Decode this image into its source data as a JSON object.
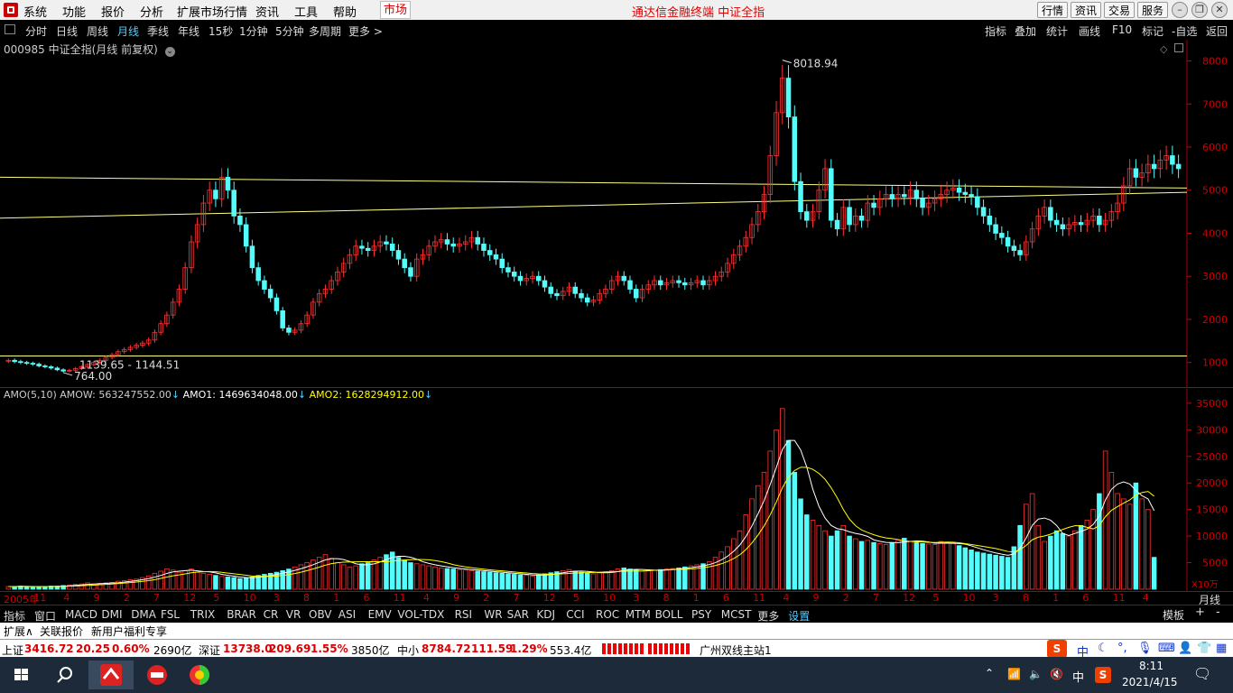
{
  "menubar": {
    "items": [
      "系统",
      "功能",
      "报价",
      "分析",
      "扩展市场行情",
      "资讯",
      "工具",
      "帮助"
    ],
    "market_tab": "市场",
    "title": "通达信金融终端  中证全指",
    "buttons": [
      "行情",
      "资讯",
      "交易",
      "服务"
    ]
  },
  "periods": [
    "分时",
    "日线",
    "周线",
    "月线",
    "季线",
    "年线",
    "15秒",
    "1分钟",
    "5分钟",
    "多周期",
    "更多 >"
  ],
  "right_tools": [
    "指标",
    "叠加",
    "统计",
    "画线",
    "F10",
    "标记",
    "-自选",
    "返回"
  ],
  "stock": {
    "label": "000985 中证全指(月线 前复权)",
    "high_label": "8018.94",
    "low_label": "764.00",
    "range_label": "1139.65 - 1144.51"
  },
  "amo": {
    "name": "AMO(5,10)",
    "amow": "AMOW: 563247552.00",
    "amo1": "AMO1: 1469634048.00",
    "amo2": "AMO2: 1628294912.00",
    "unit": "X10万"
  },
  "price_axis": [
    "8000",
    "7000",
    "6000",
    "5000",
    "4000",
    "3000",
    "2000",
    "1000"
  ],
  "volume_axis": [
    "35000",
    "30000",
    "25000",
    "20000",
    "15000",
    "10000",
    "5000"
  ],
  "time_axis": [
    "2005年",
    "11",
    "4",
    "9",
    "2",
    "7",
    "12",
    "5",
    "10",
    "3",
    "8",
    "1",
    "6",
    "11",
    "4",
    "9",
    "2",
    "7",
    "12",
    "5",
    "10",
    "3",
    "8",
    "1",
    "6",
    "11",
    "4",
    "9",
    "2",
    "7",
    "12",
    "5",
    "10",
    "3",
    "8",
    "1",
    "6",
    "11",
    "4"
  ],
  "period_label": "月线",
  "indicator_tabs": [
    "指标",
    "窗口",
    "MACD",
    "DMI",
    "DMA",
    "FSL",
    "TRIX",
    "BRAR",
    "CR",
    "VR",
    "OBV",
    "ASI",
    "EMV",
    "VOL-TDX",
    "RSI",
    "WR",
    "SAR",
    "KDJ",
    "CCI",
    "ROC",
    "MTM",
    "BOLL",
    "PSY",
    "MCST",
    "更多",
    "设置"
  ],
  "template_label": "模板",
  "ext_row": [
    "扩展∧",
    "关联报价",
    "新用户福利专享"
  ],
  "status": {
    "sh_name": "上证",
    "sh_val": "3416.72",
    "sh_chg": "20.25",
    "sh_pct": "0.60%",
    "sh_amt": "2690亿",
    "sz_name": "深证",
    "sz_val": "13738.0",
    "sz_chg": "209.69",
    "sz_pct": "1.55%",
    "sz_amt": "3850亿",
    "zx_name": "中小",
    "zx_val": "8784.72",
    "zx_chg": "111.59",
    "zx_pct": "1.29%",
    "zx_amt": "553.4亿",
    "server": "广州双线主站1"
  },
  "taskbar": {
    "time": "8:11",
    "date": "2021/4/15",
    "ime": "中"
  },
  "colors": {
    "up": "#ff3232",
    "down": "#54fcfc",
    "ma1": "#ffffff",
    "ma2": "#ffff00",
    "line": "#ffff80"
  },
  "chart_data": {
    "type": "candlestick",
    "title": "000985 中证全指(月线 前复权)",
    "ylim": [
      700,
      8200
    ],
    "y_ticks": [
      1000,
      2000,
      3000,
      4000,
      5000,
      6000,
      7000,
      8000
    ],
    "closes": [
      1050,
      1020,
      1000,
      980,
      960,
      920,
      900,
      870,
      830,
      800,
      820,
      860,
      900,
      950,
      1000,
      1050,
      1120,
      1180,
      1250,
      1300,
      1350,
      1400,
      1450,
      1520,
      1700,
      1900,
      2100,
      2400,
      2700,
      3200,
      3800,
      4200,
      4700,
      5000,
      4800,
      5300,
      5000,
      4400,
      4200,
      3700,
      3200,
      2900,
      2700,
      2500,
      2200,
      1800,
      1700,
      1750,
      1900,
      2100,
      2400,
      2600,
      2700,
      2900,
      3100,
      3300,
      3500,
      3700,
      3650,
      3600,
      3700,
      3800,
      3750,
      3600,
      3400,
      3200,
      3000,
      3400,
      3500,
      3700,
      3800,
      3850,
      3750,
      3700,
      3750,
      3800,
      3900,
      3750,
      3600,
      3500,
      3400,
      3200,
      3100,
      3000,
      2900,
      2950,
      3000,
      2900,
      2750,
      2600,
      2550,
      2650,
      2750,
      2600,
      2500,
      2400,
      2450,
      2600,
      2700,
      2900,
      3000,
      2900,
      2700,
      2500,
      2700,
      2800,
      2900,
      2800,
      2850,
      2900,
      2850,
      2800,
      2850,
      2900,
      2800,
      2900,
      3000,
      3100,
      3300,
      3500,
      3700,
      3900,
      4200,
      4500,
      4900,
      5800,
      6800,
      7600,
      6700,
      5200,
      4500,
      4300,
      4500,
      5000,
      5500,
      4300,
      4100,
      4600,
      4200,
      4400,
      4300,
      4700,
      4600,
      4800,
      4900,
      4800,
      4900,
      4850,
      5000,
      4800,
      4600,
      4700,
      4800,
      4900,
      5000,
      5050,
      4950,
      4900,
      4850,
      4600,
      4400,
      4200,
      4000,
      3900,
      3700,
      3600,
      3500,
      3800,
      4100,
      4400,
      4600,
      4300,
      4200,
      4100,
      4200,
      4250,
      4200,
      4300,
      4400,
      4200,
      4300,
      4500,
      4700,
      5100,
      5500,
      5300,
      5400,
      5600,
      5500,
      5700,
      5800,
      5600,
      5500
    ],
    "hlines": [
      1150
    ],
    "trendlines": [
      [
        5300,
        5050
      ],
      [
        4350,
        4950
      ]
    ],
    "volume_ylim": [
      0,
      36000
    ],
    "volume": [
      500,
      500,
      600,
      500,
      500,
      400,
      500,
      600,
      600,
      700,
      800,
      900,
      1000,
      1200,
      1000,
      1100,
      1200,
      1300,
      1500,
      1600,
      1800,
      1900,
      2200,
      2500,
      3000,
      3400,
      3800,
      3600,
      3200,
      3500,
      3800,
      3200,
      3000,
      2800,
      2600,
      2400,
      2300,
      2200,
      2000,
      2100,
      2300,
      2600,
      2800,
      3000,
      3200,
      3500,
      3800,
      4200,
      4600,
      5000,
      5500,
      6000,
      6500,
      5800,
      5000,
      4600,
      4200,
      4400,
      4800,
      5000,
      5500,
      6000,
      6500,
      7000,
      6000,
      5500,
      5000,
      4800,
      4600,
      4400,
      4200,
      4000,
      3900,
      3800,
      3700,
      3600,
      3500,
      3400,
      3300,
      3200,
      3100,
      3000,
      2900,
      2800,
      2700,
      2600,
      2500,
      2700,
      2900,
      3100,
      3300,
      3500,
      3700,
      3400,
      3200,
      3000,
      2900,
      3100,
      3300,
      3500,
      3800,
      4000,
      3800,
      3600,
      3400,
      3500,
      3600,
      3700,
      3800,
      3900,
      4000,
      4200,
      4400,
      4600,
      4800,
      5200,
      6000,
      7000,
      8000,
      9500,
      11000,
      14000,
      17000,
      19500,
      22000,
      26000,
      30000,
      34000,
      28000,
      22000,
      17000,
      14000,
      13000,
      12000,
      11000,
      10000,
      11000,
      12000,
      10000,
      9500,
      9000,
      9200,
      8800,
      8600,
      8400,
      8800,
      9200,
      9600,
      9000,
      8800,
      8600,
      8500,
      8400,
      9000,
      8800,
      8600,
      8200,
      7800,
      7400,
      7000,
      6800,
      6600,
      6400,
      6200,
      6000,
      8000,
      12000,
      16000,
      18000,
      12000,
      9000,
      10000,
      11000,
      10500,
      10000,
      11000,
      12000,
      13000,
      15000,
      18000,
      26000,
      22000,
      18000,
      17000,
      16000,
      20000,
      17000,
      15000,
      6000
    ],
    "last_n_shown": 200
  }
}
